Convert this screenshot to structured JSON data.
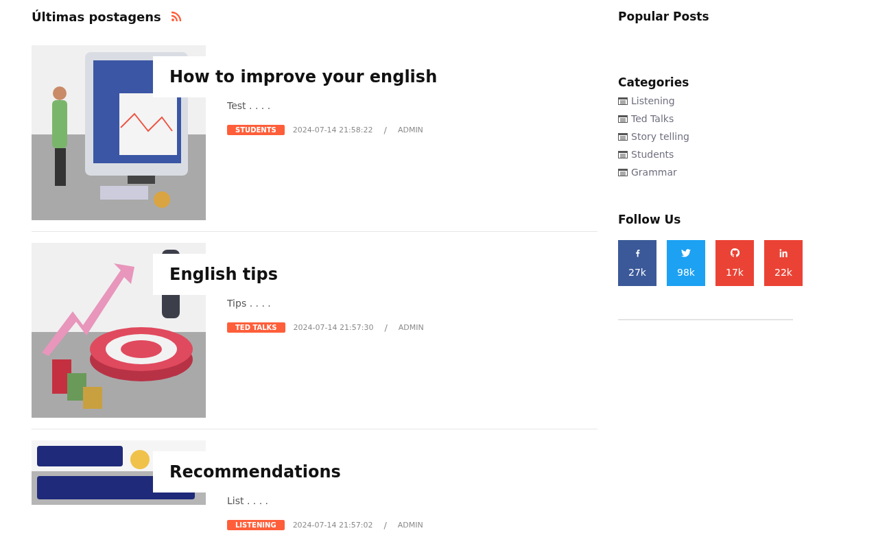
{
  "main": {
    "heading": "Últimas postagens",
    "posts": [
      {
        "title": "How to improve your english",
        "excerpt": "Test . . . .",
        "category": "STUDENTS",
        "date": "2024-07-14 21:58:22",
        "separator": "/",
        "author": "ADMIN"
      },
      {
        "title": "English tips",
        "excerpt": "Tips . . . .",
        "category": "TED TALKS",
        "date": "2024-07-14 21:57:30",
        "separator": "/",
        "author": "ADMIN"
      },
      {
        "title": "Recommendations",
        "excerpt": "List . . . .",
        "category": "LISTENING",
        "date": "2024-07-14 21:57:02",
        "separator": "/",
        "author": "ADMIN"
      }
    ]
  },
  "sidebar": {
    "popular_title": "Popular Posts",
    "categories_title": "Categories",
    "categories": [
      "Listening",
      "Ted Talks",
      "Story telling",
      "Students",
      "Grammar"
    ],
    "follow_title": "Follow Us",
    "social": [
      {
        "kind": "facebook",
        "count": "27k",
        "color": "#3b5998"
      },
      {
        "kind": "twitter",
        "count": "98k",
        "color": "#1da1f2"
      },
      {
        "kind": "github",
        "count": "17k",
        "color": "#ea4335"
      },
      {
        "kind": "linkedin",
        "count": "22k",
        "color": "#ea4335"
      }
    ]
  }
}
